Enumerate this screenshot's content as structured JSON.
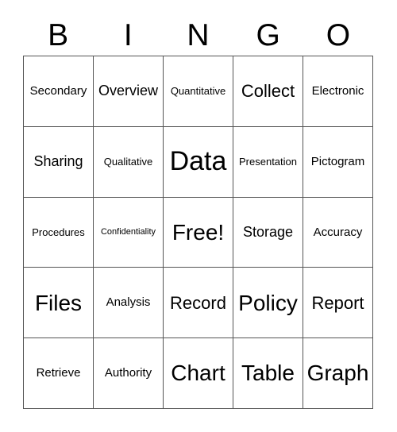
{
  "header": {
    "letters": [
      "B",
      "I",
      "N",
      "G",
      "O"
    ]
  },
  "grid": {
    "rows": [
      {
        "cells": [
          {
            "text": "Secondary",
            "size": "sz-md"
          },
          {
            "text": "Overview",
            "size": "sz-lg"
          },
          {
            "text": "Quantitative",
            "size": "sz-sm"
          },
          {
            "text": "Collect",
            "size": "sz-xl"
          },
          {
            "text": "Electronic",
            "size": "sz-md"
          }
        ]
      },
      {
        "cells": [
          {
            "text": "Sharing",
            "size": "sz-lg"
          },
          {
            "text": "Qualitative",
            "size": "sz-sm"
          },
          {
            "text": "Data",
            "size": "sz-huge"
          },
          {
            "text": "Presentation",
            "size": "sz-sm"
          },
          {
            "text": "Pictogram",
            "size": "sz-md"
          }
        ]
      },
      {
        "cells": [
          {
            "text": "Procedures",
            "size": "sz-sm"
          },
          {
            "text": "Confidentiality",
            "size": "sz-xs"
          },
          {
            "text": "Free!",
            "size": "sz-xxl"
          },
          {
            "text": "Storage",
            "size": "sz-lg"
          },
          {
            "text": "Accuracy",
            "size": "sz-md"
          }
        ]
      },
      {
        "cells": [
          {
            "text": "Files",
            "size": "sz-xxl"
          },
          {
            "text": "Analysis",
            "size": "sz-md"
          },
          {
            "text": "Record",
            "size": "sz-xl"
          },
          {
            "text": "Policy",
            "size": "sz-xxl"
          },
          {
            "text": "Report",
            "size": "sz-xl"
          }
        ]
      },
      {
        "cells": [
          {
            "text": "Retrieve",
            "size": "sz-md"
          },
          {
            "text": "Authority",
            "size": "sz-md"
          },
          {
            "text": "Chart",
            "size": "sz-xxl"
          },
          {
            "text": "Table",
            "size": "sz-xxl"
          },
          {
            "text": "Graph",
            "size": "sz-xxl"
          }
        ]
      }
    ]
  },
  "colors": {
    "grid_line": "#555555",
    "text": "#000000",
    "background": "#ffffff"
  }
}
